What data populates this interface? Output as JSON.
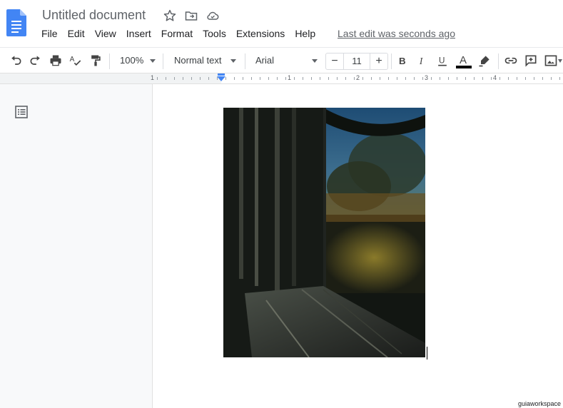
{
  "document": {
    "title": "Untitled document",
    "last_edit": "Last edit was seconds ago"
  },
  "menu": [
    "File",
    "Edit",
    "View",
    "Insert",
    "Format",
    "Tools",
    "Extensions",
    "Help"
  ],
  "toolbar": {
    "zoom": "100%",
    "style": "Normal text",
    "font": "Arial",
    "font_size": "11",
    "minus": "−",
    "plus": "+",
    "icons": [
      "undo-icon",
      "redo-icon",
      "print-icon",
      "spellcheck-icon",
      "paint-format-icon",
      "bold-icon",
      "italic-icon",
      "underline-icon",
      "text-color-icon",
      "highlight-icon",
      "link-icon",
      "comment-icon",
      "image-icon"
    ]
  },
  "ruler": {
    "labels": [
      "1",
      "1",
      "2",
      "3",
      "4"
    ]
  },
  "watermark": "guiaworkspace",
  "colors": {
    "docs_blue": "#4285f4",
    "text_color_bar": "#000000",
    "ruler_marker": "#4285f4"
  }
}
